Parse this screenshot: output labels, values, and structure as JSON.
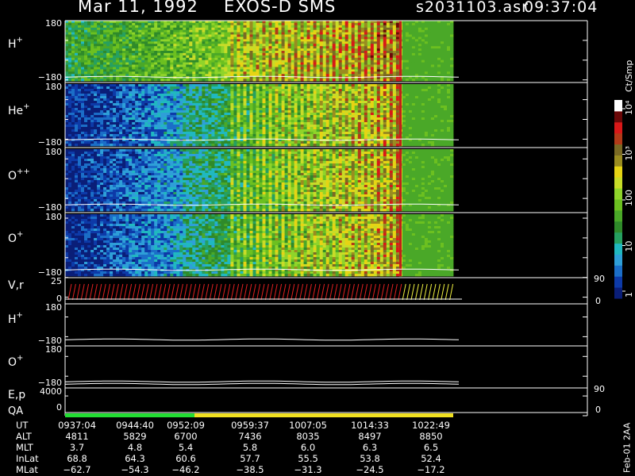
{
  "header": {
    "date": "Mar 11, 1992",
    "instrument": "EXOS-D SMS",
    "file": "s2031103.asr",
    "time": "09:37:04"
  },
  "footer_side_label": "Feb-01 2AA",
  "colors": {
    "background": "#000000",
    "qa_good": "#22dd33",
    "qa_caution": "#f0e020"
  },
  "chart_data": {
    "type": "heatmap",
    "colorbar": {
      "title": "Ct/Smp",
      "tick_labels": [
        "1",
        "10",
        "100",
        "10³",
        "10⁴"
      ],
      "scale": "log",
      "range": [
        1,
        10000
      ]
    },
    "time_axis": {
      "label": "UT",
      "ticks": [
        "0937:04",
        "0944:40",
        "0952:09",
        "0959:37",
        "1007:05",
        "1014:33",
        "1022:49"
      ]
    },
    "panels": [
      {
        "label": "H+",
        "sup": "+",
        "base": "H",
        "y_top": "180",
        "y_bottom": "−180",
        "type": "spectrogram"
      },
      {
        "label": "He+",
        "sup": "+",
        "base": "He",
        "y_top": "180",
        "y_bottom": "−180",
        "type": "spectrogram"
      },
      {
        "label": "O++",
        "sup": "++",
        "base": "O",
        "y_top": "180",
        "y_bottom": "−180",
        "type": "spectrogram"
      },
      {
        "label": "O+",
        "sup": "+",
        "base": "O",
        "y_top": "180",
        "y_bottom": "−180",
        "type": "spectrogram"
      },
      {
        "label": "V,r",
        "base": "V,r",
        "sup": "",
        "y_top": "25",
        "y_bottom": "0",
        "y_right_top": "90",
        "y_right_bottom": "0",
        "type": "line"
      },
      {
        "label": "H+",
        "sup": "+",
        "base": "H",
        "y_top": "180",
        "y_bottom": "−180",
        "type": "line"
      },
      {
        "label": "O+",
        "sup": "+",
        "base": "O",
        "y_top": "180",
        "y_bottom": "−180",
        "type": "line"
      },
      {
        "label": "E,p",
        "base": "E,p",
        "sup": "",
        "y_top": "4000",
        "y_bottom": "0",
        "y_right_top": "90",
        "y_right_bottom": "0",
        "type": "line"
      }
    ],
    "qa": {
      "label": "QA",
      "segments": [
        {
          "from": "0937:04",
          "to": "0952:09",
          "status": "good"
        },
        {
          "from": "0952:09",
          "to": "1022:49",
          "status": "caution"
        }
      ]
    },
    "orbit_table": [
      {
        "label": "UT",
        "values": [
          "0937:04",
          "0944:40",
          "0952:09",
          "0959:37",
          "1007:05",
          "1014:33",
          "1022:49"
        ]
      },
      {
        "label": "ALT",
        "values": [
          "4811",
          "5829",
          "6700",
          "7436",
          "8035",
          "8497",
          "8850"
        ]
      },
      {
        "label": "MLT",
        "values": [
          "3.7",
          "4.8",
          "5.4",
          "5.8",
          "6.0",
          "6.3",
          "6.5"
        ]
      },
      {
        "label": "InLat",
        "values": [
          "68.8",
          "64.3",
          "60.6",
          "57.7",
          "55.5",
          "53.8",
          "52.4"
        ]
      },
      {
        "label": "MLat",
        "values": [
          "−62.7",
          "−54.3",
          "−46.2",
          "−38.5",
          "−31.3",
          "−24.5",
          "−17.2"
        ]
      }
    ]
  }
}
